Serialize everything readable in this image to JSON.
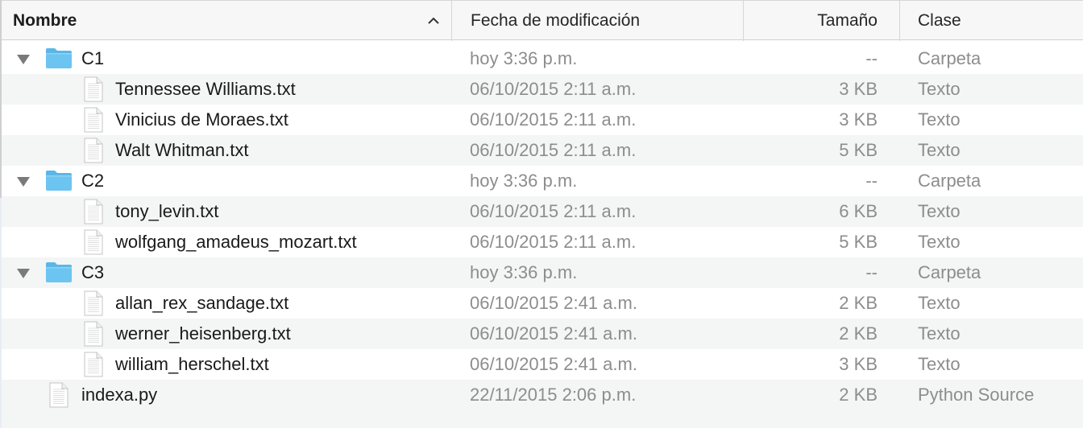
{
  "header": {
    "name": "Nombre",
    "date": "Fecha de modificación",
    "size": "Tamaño",
    "kind": "Clase"
  },
  "rows": [
    {
      "name": "C1",
      "date": "hoy 3:36 p.m.",
      "size": "--",
      "kind": "Carpeta",
      "type": "folder"
    },
    {
      "name": "Tennessee Williams.txt",
      "date": "06/10/2015 2:11 a.m.",
      "size": "3 KB",
      "kind": "Texto",
      "type": "file"
    },
    {
      "name": "Vinicius de Moraes.txt",
      "date": "06/10/2015 2:11 a.m.",
      "size": "3 KB",
      "kind": "Texto",
      "type": "file"
    },
    {
      "name": "Walt Whitman.txt",
      "date": "06/10/2015 2:11 a.m.",
      "size": "5 KB",
      "kind": "Texto",
      "type": "file"
    },
    {
      "name": "C2",
      "date": "hoy 3:36 p.m.",
      "size": "--",
      "kind": "Carpeta",
      "type": "folder"
    },
    {
      "name": "tony_levin.txt",
      "date": "06/10/2015 2:11 a.m.",
      "size": "6 KB",
      "kind": "Texto",
      "type": "file"
    },
    {
      "name": "wolfgang_amadeus_mozart.txt",
      "date": "06/10/2015 2:11 a.m.",
      "size": "5 KB",
      "kind": "Texto",
      "type": "file"
    },
    {
      "name": "C3",
      "date": "hoy 3:36 p.m.",
      "size": "--",
      "kind": "Carpeta",
      "type": "folder"
    },
    {
      "name": "allan_rex_sandage.txt",
      "date": "06/10/2015 2:41 a.m.",
      "size": "2 KB",
      "kind": "Texto",
      "type": "file"
    },
    {
      "name": "werner_heisenberg.txt",
      "date": "06/10/2015 2:41 a.m.",
      "size": "2 KB",
      "kind": "Texto",
      "type": "file"
    },
    {
      "name": "william_herschel.txt",
      "date": "06/10/2015 2:41 a.m.",
      "size": "3 KB",
      "kind": "Texto",
      "type": "file"
    },
    {
      "name": "indexa.py",
      "date": "22/11/2015 2:06 p.m.",
      "size": "2 KB",
      "kind": "Python Source",
      "type": "toplevel-file"
    }
  ],
  "colors": {
    "folder": "#6cc4f0",
    "secondary_text": "#8d8d8d",
    "alt_row": "#f4f5f5"
  },
  "icons": {
    "folder": "folder-icon",
    "file": "text-document-icon",
    "disclosure": "disclosure-triangle-down-icon",
    "sort": "sort-ascending-chevron-icon"
  }
}
